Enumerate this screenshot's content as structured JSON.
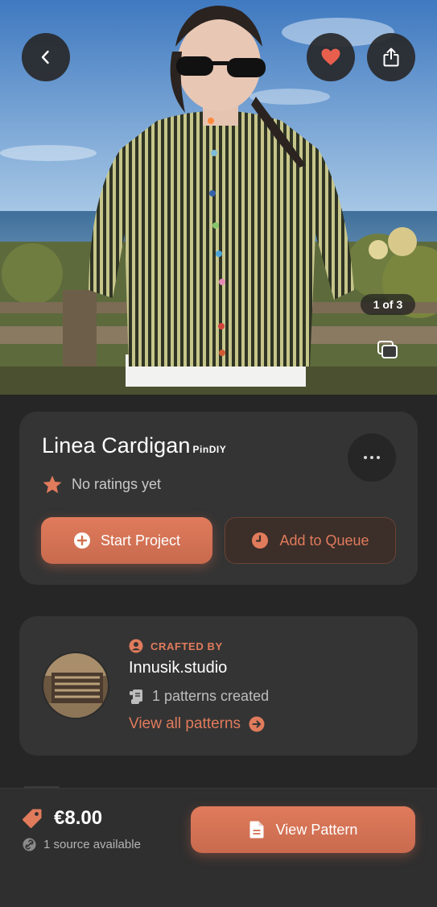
{
  "gallery": {
    "counter": "1 of 3",
    "current": 1,
    "total": 3
  },
  "header": {
    "back_icon": "chevron-left-icon",
    "favorite_icon": "heart-icon",
    "share_icon": "share-icon",
    "favorited": true
  },
  "pattern": {
    "title": "Linea Cardigan",
    "brand_mark": "PinDIY",
    "rating_text": "No ratings yet",
    "start_label": "Start Project",
    "queue_label": "Add to Queue"
  },
  "creator": {
    "section_label": "CRAFTED BY",
    "name": "Innusik.studio",
    "patterns_count_text": "1 patterns created",
    "view_all_label": "View all patterns"
  },
  "purchase": {
    "price": "€8.00",
    "sources_text": "1 source available",
    "view_label": "View Pattern"
  },
  "colors": {
    "accent": "#E07B5C",
    "background": "#262626",
    "card": "#343434",
    "heart": "#E85F4E"
  }
}
